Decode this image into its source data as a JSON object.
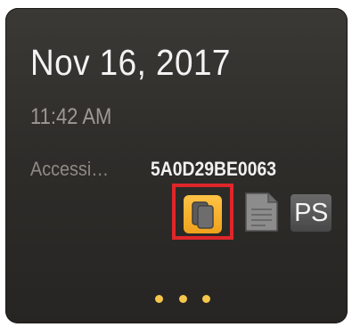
{
  "card": {
    "date": "Nov 16, 2017",
    "time": "11:42 AM",
    "accession_label": "Accessi…",
    "accession_value": "5A0D29BE0063"
  },
  "actions": {
    "ps_label": "PS"
  },
  "icons": {
    "stack": "stacked-copies-icon",
    "document": "document-icon"
  },
  "pager": {
    "dot_count": 3
  },
  "colors": {
    "card_background": "#2f2d2a",
    "accent_orange": "#f0a21b",
    "highlight_red": "#e0262a",
    "dot_yellow": "#f4c64a"
  }
}
